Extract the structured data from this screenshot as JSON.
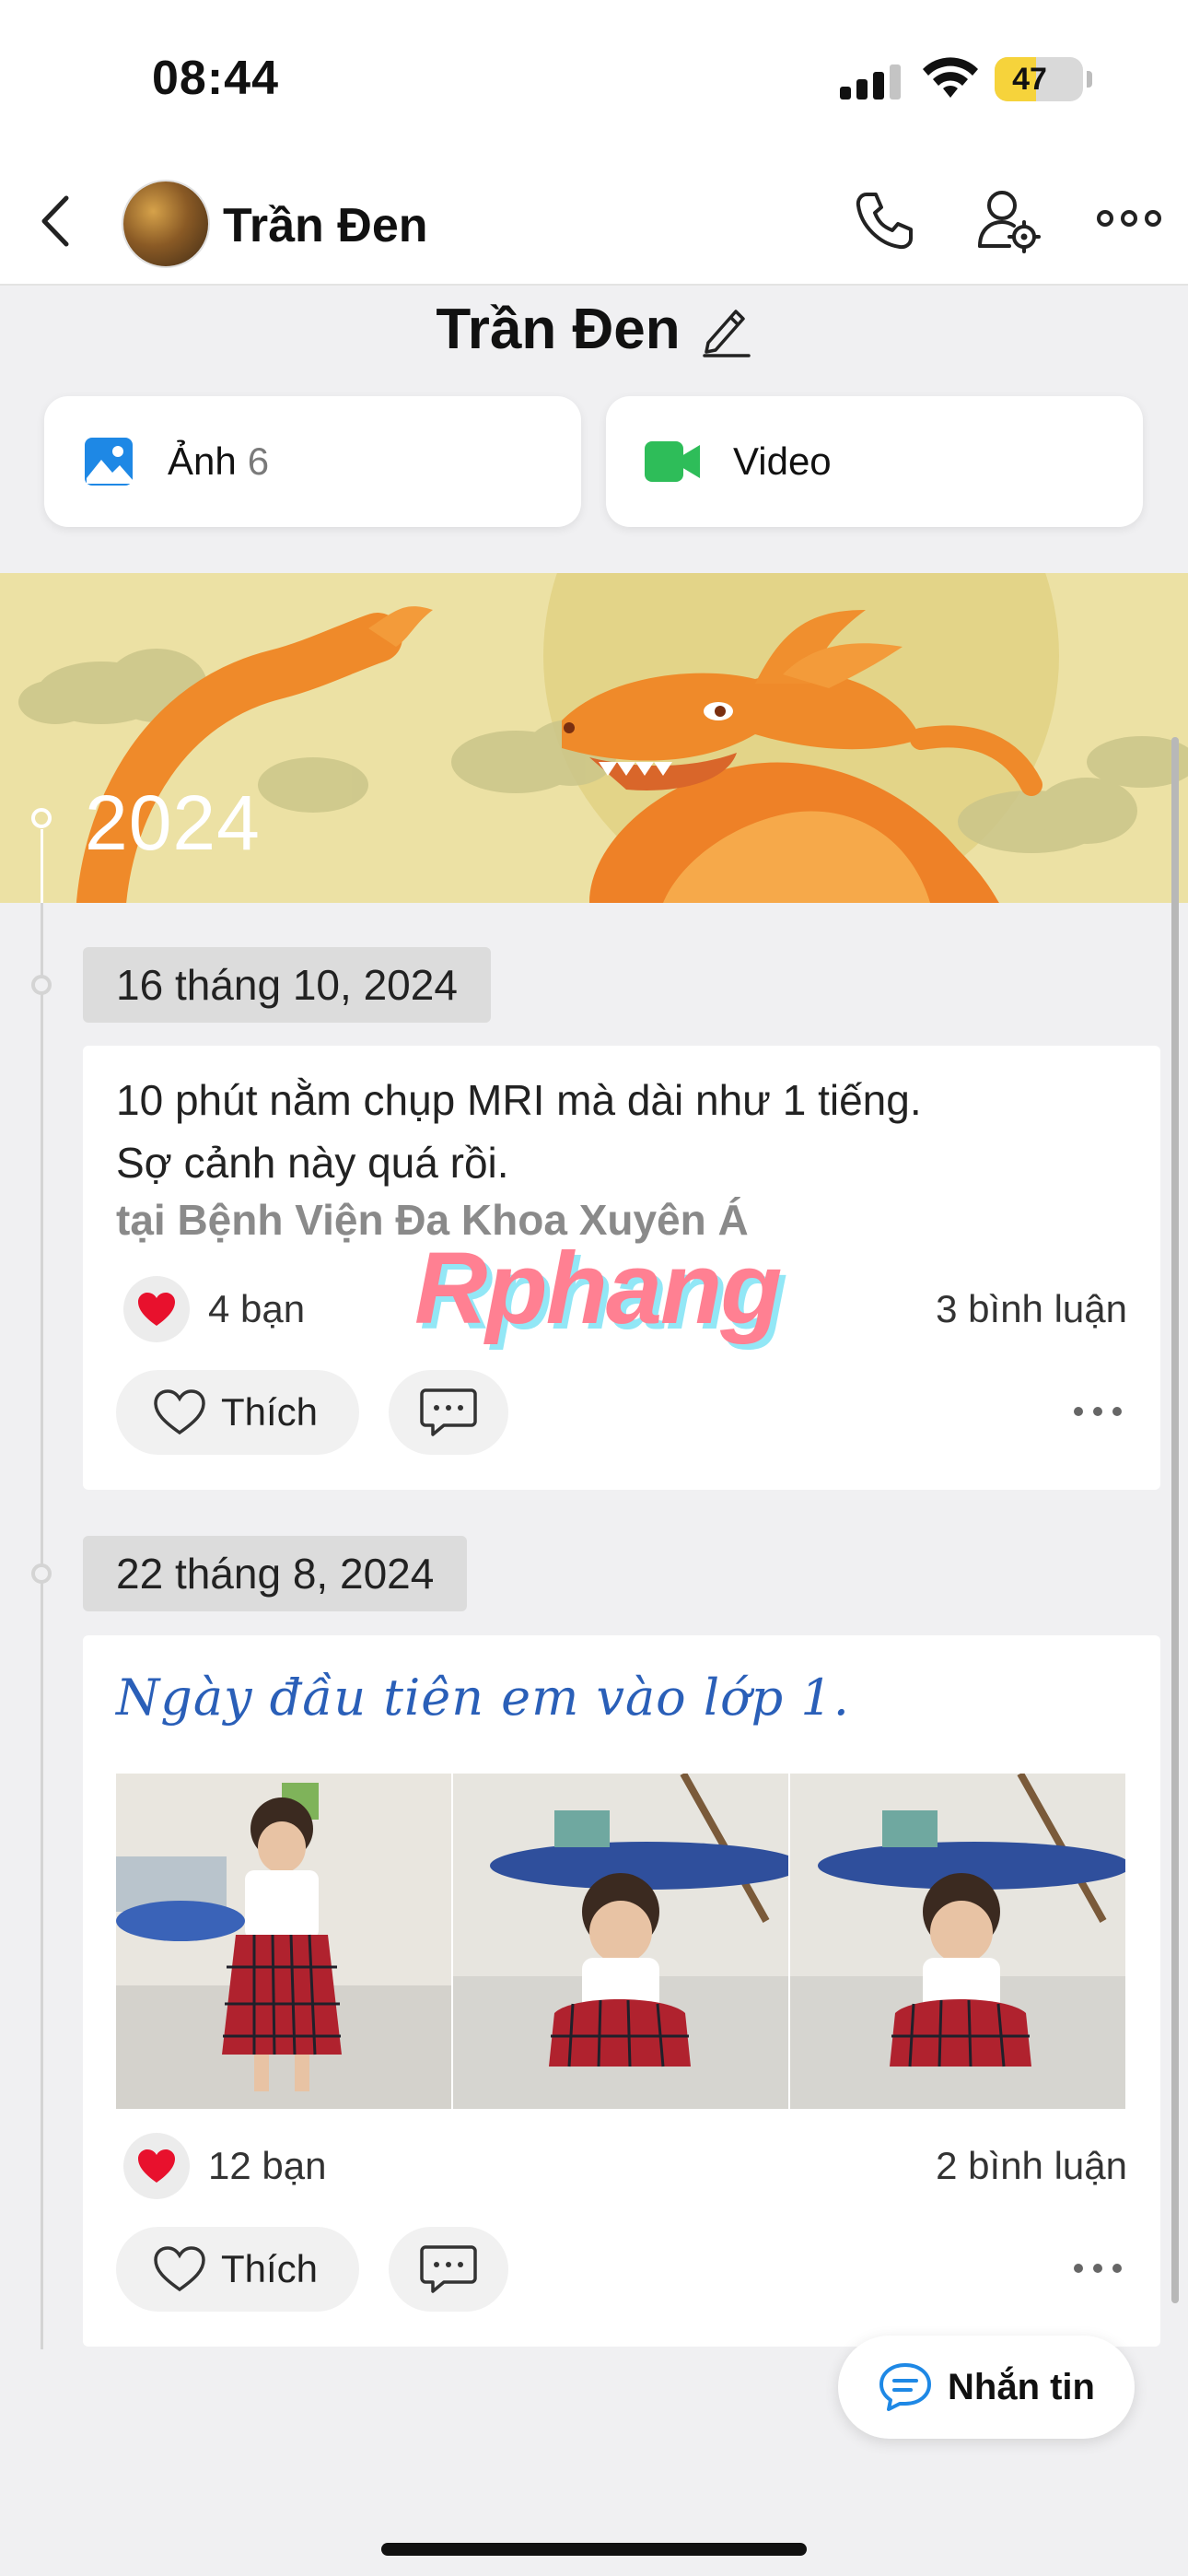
{
  "status_bar": {
    "time": "08:44",
    "battery": "47",
    "battery_level": 0.47
  },
  "header": {
    "name": "Trần Đen"
  },
  "profile": {
    "title": "Trần Đen"
  },
  "media": {
    "photos_label": "Ảnh",
    "photos_count": "6",
    "video_label": "Video"
  },
  "year_banner": {
    "year": "2024"
  },
  "posts": [
    {
      "date": "16 tháng 10, 2024",
      "text_line1": "10 phút nằm chụp MRI mà dài như 1 tiếng.",
      "text_line2": "Sợ cảnh này quá rồi.",
      "location": "tại Bệnh Viện Đa Khoa Xuyên Á",
      "reactions": "4 bạn",
      "comments": "3 bình luận",
      "like_label": "Thích"
    },
    {
      "date": "22 tháng 8, 2024",
      "caption": "Ngày đầu tiên em vào lớp 1.",
      "reactions": "12 bạn",
      "comments": "2 bình luận",
      "like_label": "Thích"
    }
  ],
  "watermark": "Rphang",
  "message_button": {
    "label": "Nhắn tin"
  },
  "colors": {
    "accent_blue": "#1e88e5",
    "video_green": "#2ebd59",
    "heart_red": "#e8112d",
    "banner_yellow": "#ece1a4"
  }
}
